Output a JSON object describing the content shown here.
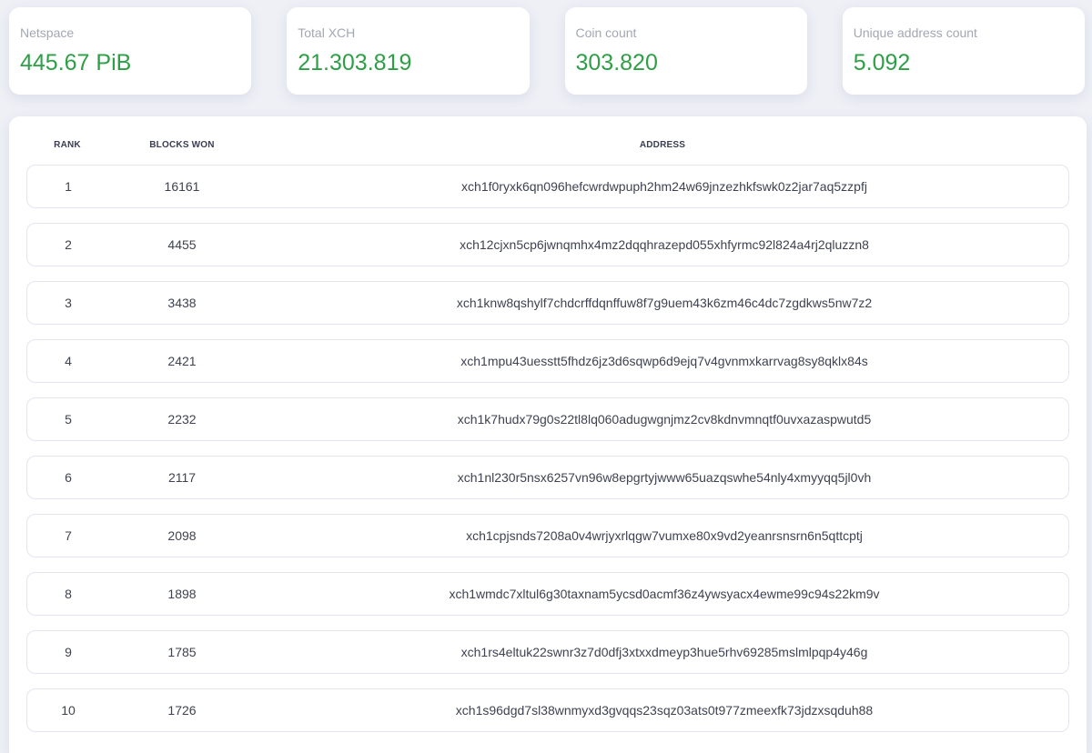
{
  "stats": [
    {
      "label": "Netspace",
      "value": "445.67 PiB",
      "color": "#2e9f46"
    },
    {
      "label": "Total XCH",
      "value": "21.303.819",
      "color": "#2e9f46"
    },
    {
      "label": "Coin count",
      "value": "303.820",
      "color": "#2e9f46"
    },
    {
      "label": "Unique address count",
      "value": "5.092",
      "color": "#2e9f46"
    }
  ],
  "table": {
    "headers": {
      "rank": "RANK",
      "blocks_won": "BLOCKS WON",
      "address": "ADDRESS"
    },
    "rows": [
      {
        "rank": "1",
        "blocks_won": "16161",
        "address": "xch1f0ryxk6qn096hefcwrdwpuph2hm24w69jnzezhkfswk0z2jar7aq5zzpfj"
      },
      {
        "rank": "2",
        "blocks_won": "4455",
        "address": "xch12cjxn5cp6jwnqmhx4mz2dqqhrazepd055xhfyrmc92l824a4rj2qluzzn8"
      },
      {
        "rank": "3",
        "blocks_won": "3438",
        "address": "xch1knw8qshylf7chdcrffdqnffuw8f7g9uem43k6zm46c4dc7zgdkws5nw7z2"
      },
      {
        "rank": "4",
        "blocks_won": "2421",
        "address": "xch1mpu43uesstt5fhdz6jz3d6sqwp6d9ejq7v4gvnmxkarrvag8sy8qklx84s"
      },
      {
        "rank": "5",
        "blocks_won": "2232",
        "address": "xch1k7hudx79g0s22tl8lq060adugwgnjmz2cv8kdnvmnqtf0uvxazaspwutd5"
      },
      {
        "rank": "6",
        "blocks_won": "2117",
        "address": "xch1nl230r5nsx6257vn96w8epgrtyjwww65uazqswhe54nly4xmyyqq5jl0vh"
      },
      {
        "rank": "7",
        "blocks_won": "2098",
        "address": "xch1cpjsnds7208a0v4wrjyxrlqgw7vumxe80x9vd2yeanrsnsrn6n5qttcptj"
      },
      {
        "rank": "8",
        "blocks_won": "1898",
        "address": "xch1wmdc7xltul6g30taxnam5ycsd0acmf36z4ywsyacx4ewme99c94s22km9v"
      },
      {
        "rank": "9",
        "blocks_won": "1785",
        "address": "xch1rs4eltuk22swnr3z7d0dfj3xtxxdmeyp3hue5rhv69285mslmlpqp4y46g"
      },
      {
        "rank": "10",
        "blocks_won": "1726",
        "address": "xch1s96dgd7sl38wnmyxd3gvqqs23sqz03ats0t977zmeexfk73jdzxsqduh88"
      }
    ]
  }
}
